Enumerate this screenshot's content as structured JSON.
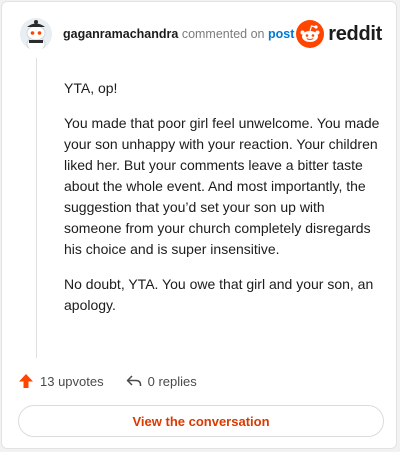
{
  "comment": {
    "username": "gaganramachandra",
    "action_text": "commented on",
    "post_link": "post",
    "paragraphs": [
      "YTA, op!",
      "You made that poor girl feel unwelcome. You made your son unhappy with your reaction. Your children liked her. But your comments leave a bitter taste about the whole event. And most importantly, the suggestion that you’d set your son up with someone from your church completely disregards his choice and is super insensitive.",
      "No doubt, YTA. You owe that girl and your son, an apology."
    ],
    "upvotes": "13 upvotes",
    "replies": "0 replies",
    "view_button": "View the conversation"
  },
  "brand": {
    "logo_text": "reddit",
    "accent": "#ff4500",
    "link_color": "#0079d3",
    "button_text_color": "#d93a00"
  },
  "icons": {
    "avatar": "snoo-avatar-icon",
    "logo": "reddit-alien-icon",
    "upvote": "upvote-arrow-icon",
    "reply": "reply-arrow-icon"
  }
}
